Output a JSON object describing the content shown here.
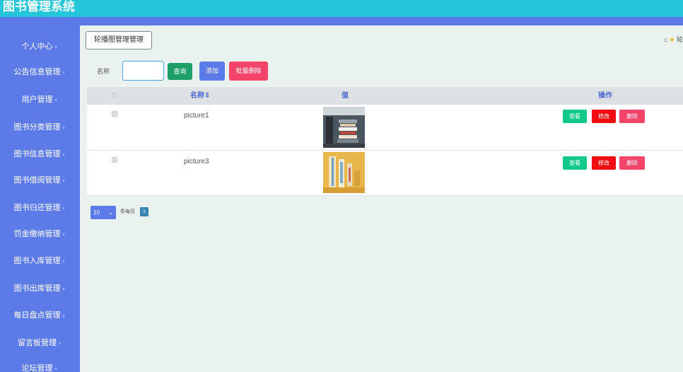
{
  "app": {
    "title": "图书管理系统"
  },
  "sidebar": {
    "items": [
      {
        "label": "个人中心"
      },
      {
        "label": "公告信息管理"
      },
      {
        "label": "用户管理"
      },
      {
        "label": "图书分类管理"
      },
      {
        "label": "图书信息管理"
      },
      {
        "label": "图书借阅管理"
      },
      {
        "label": "图书归还管理"
      },
      {
        "label": "罚金缴纳管理"
      },
      {
        "label": "图书入库管理"
      },
      {
        "label": "图书出库管理"
      },
      {
        "label": "每日盘点管理"
      },
      {
        "label": "留言板管理"
      },
      {
        "label": "论坛管理"
      }
    ]
  },
  "breadcrumb": {
    "current": "轮播图管理管理",
    "right_text": "轮"
  },
  "search": {
    "label": "名称",
    "value": "",
    "query_label": "查询",
    "add_label": "添加",
    "batch_delete_label": "批量删除"
  },
  "table": {
    "headers": {
      "name": "名称",
      "value": "值",
      "actions": "操作"
    },
    "rows": [
      {
        "name": "picture1"
      },
      {
        "name": "picture3"
      }
    ],
    "action_labels": {
      "view": "查看",
      "edit": "修改",
      "delete": "删除"
    }
  },
  "pagination": {
    "page_size": "10",
    "per_page_label": "条每页",
    "current_page": "1"
  },
  "colors": {
    "topbar": "#26c6da",
    "sidebar": "#5d7be8",
    "accent_green": "#1e9e68",
    "danger": "#f54469",
    "view": "#12c98a",
    "edit": "#f20d12"
  }
}
